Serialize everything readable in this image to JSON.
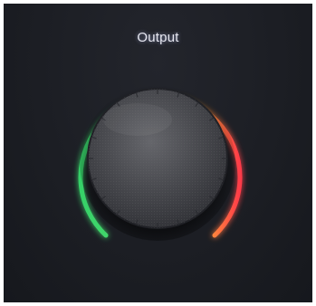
{
  "device": {
    "knob_label": "Output",
    "knob_icon": "volume-knob",
    "meter_colors": {
      "green": "#3fd46a",
      "yellow": "#d9d24a",
      "orange": "#ff9a3a",
      "red": "#ff3a4a"
    },
    "panel_color": "#1d1f25"
  }
}
